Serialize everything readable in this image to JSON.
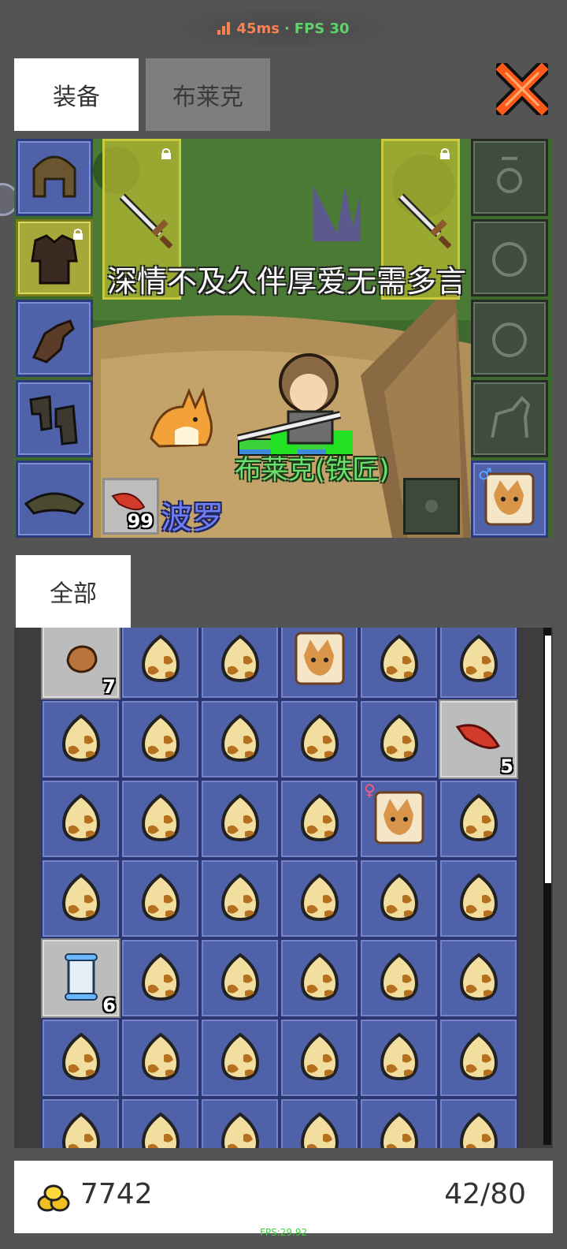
{
  "status": {
    "ping": "45ms",
    "separator": "·",
    "fps": "FPS 30"
  },
  "tabs": {
    "equipment": "装备",
    "character": "布莱克"
  },
  "scene": {
    "marquee": "深情不及久伴厚爱无需多言",
    "character_name": "布莱克(铁匠)",
    "pet_name": "波罗",
    "hp_fraction": 0.9,
    "mp_fraction": 0.85,
    "consumable_count": "99"
  },
  "category": {
    "all": "全部"
  },
  "inventory": {
    "rows": [
      [
        {
          "icon": "ore-icon",
          "count": "7",
          "gray": true
        },
        {
          "icon": "egg-icon"
        },
        {
          "icon": "egg-icon"
        },
        {
          "icon": "pet-card-icon"
        },
        {
          "icon": "egg-icon"
        },
        {
          "icon": "egg-icon"
        }
      ],
      [
        {
          "icon": "egg-icon"
        },
        {
          "icon": "egg-icon"
        },
        {
          "icon": "egg-icon"
        },
        {
          "icon": "egg-icon"
        },
        {
          "icon": "egg-icon"
        },
        {
          "icon": "feather-icon",
          "count": "5",
          "gray": true
        }
      ],
      [
        {
          "icon": "egg-icon"
        },
        {
          "icon": "egg-icon"
        },
        {
          "icon": "egg-icon"
        },
        {
          "icon": "egg-icon"
        },
        {
          "icon": "pet-card-icon",
          "female": true
        },
        {
          "icon": "egg-icon"
        }
      ],
      [
        {
          "icon": "egg-icon"
        },
        {
          "icon": "egg-icon"
        },
        {
          "icon": "egg-icon"
        },
        {
          "icon": "egg-icon"
        },
        {
          "icon": "egg-icon"
        },
        {
          "icon": "egg-icon"
        }
      ],
      [
        {
          "icon": "scroll-icon",
          "count": "6",
          "gray": true
        },
        {
          "icon": "egg-icon"
        },
        {
          "icon": "egg-icon"
        },
        {
          "icon": "egg-icon"
        },
        {
          "icon": "egg-icon"
        },
        {
          "icon": "egg-icon"
        }
      ],
      [
        {
          "icon": "egg-icon"
        },
        {
          "icon": "egg-icon"
        },
        {
          "icon": "egg-icon"
        },
        {
          "icon": "egg-icon"
        },
        {
          "icon": "egg-icon"
        },
        {
          "icon": "egg-icon"
        }
      ],
      [
        {
          "icon": "egg-icon"
        },
        {
          "icon": "egg-icon"
        },
        {
          "icon": "egg-icon"
        },
        {
          "icon": "egg-icon"
        },
        {
          "icon": "egg-icon"
        },
        {
          "icon": "egg-icon"
        }
      ]
    ],
    "scroll_fraction": 0.49
  },
  "footer": {
    "gold": "7742",
    "capacity": "42/80"
  },
  "debug": {
    "fps_small": "FPS:29.92"
  },
  "colors": {
    "accent_orange": "#ff7f50",
    "fps_green": "#5ed36b",
    "slot_blue": "#4f61a8",
    "slot_yellow": "#a6a83a"
  }
}
